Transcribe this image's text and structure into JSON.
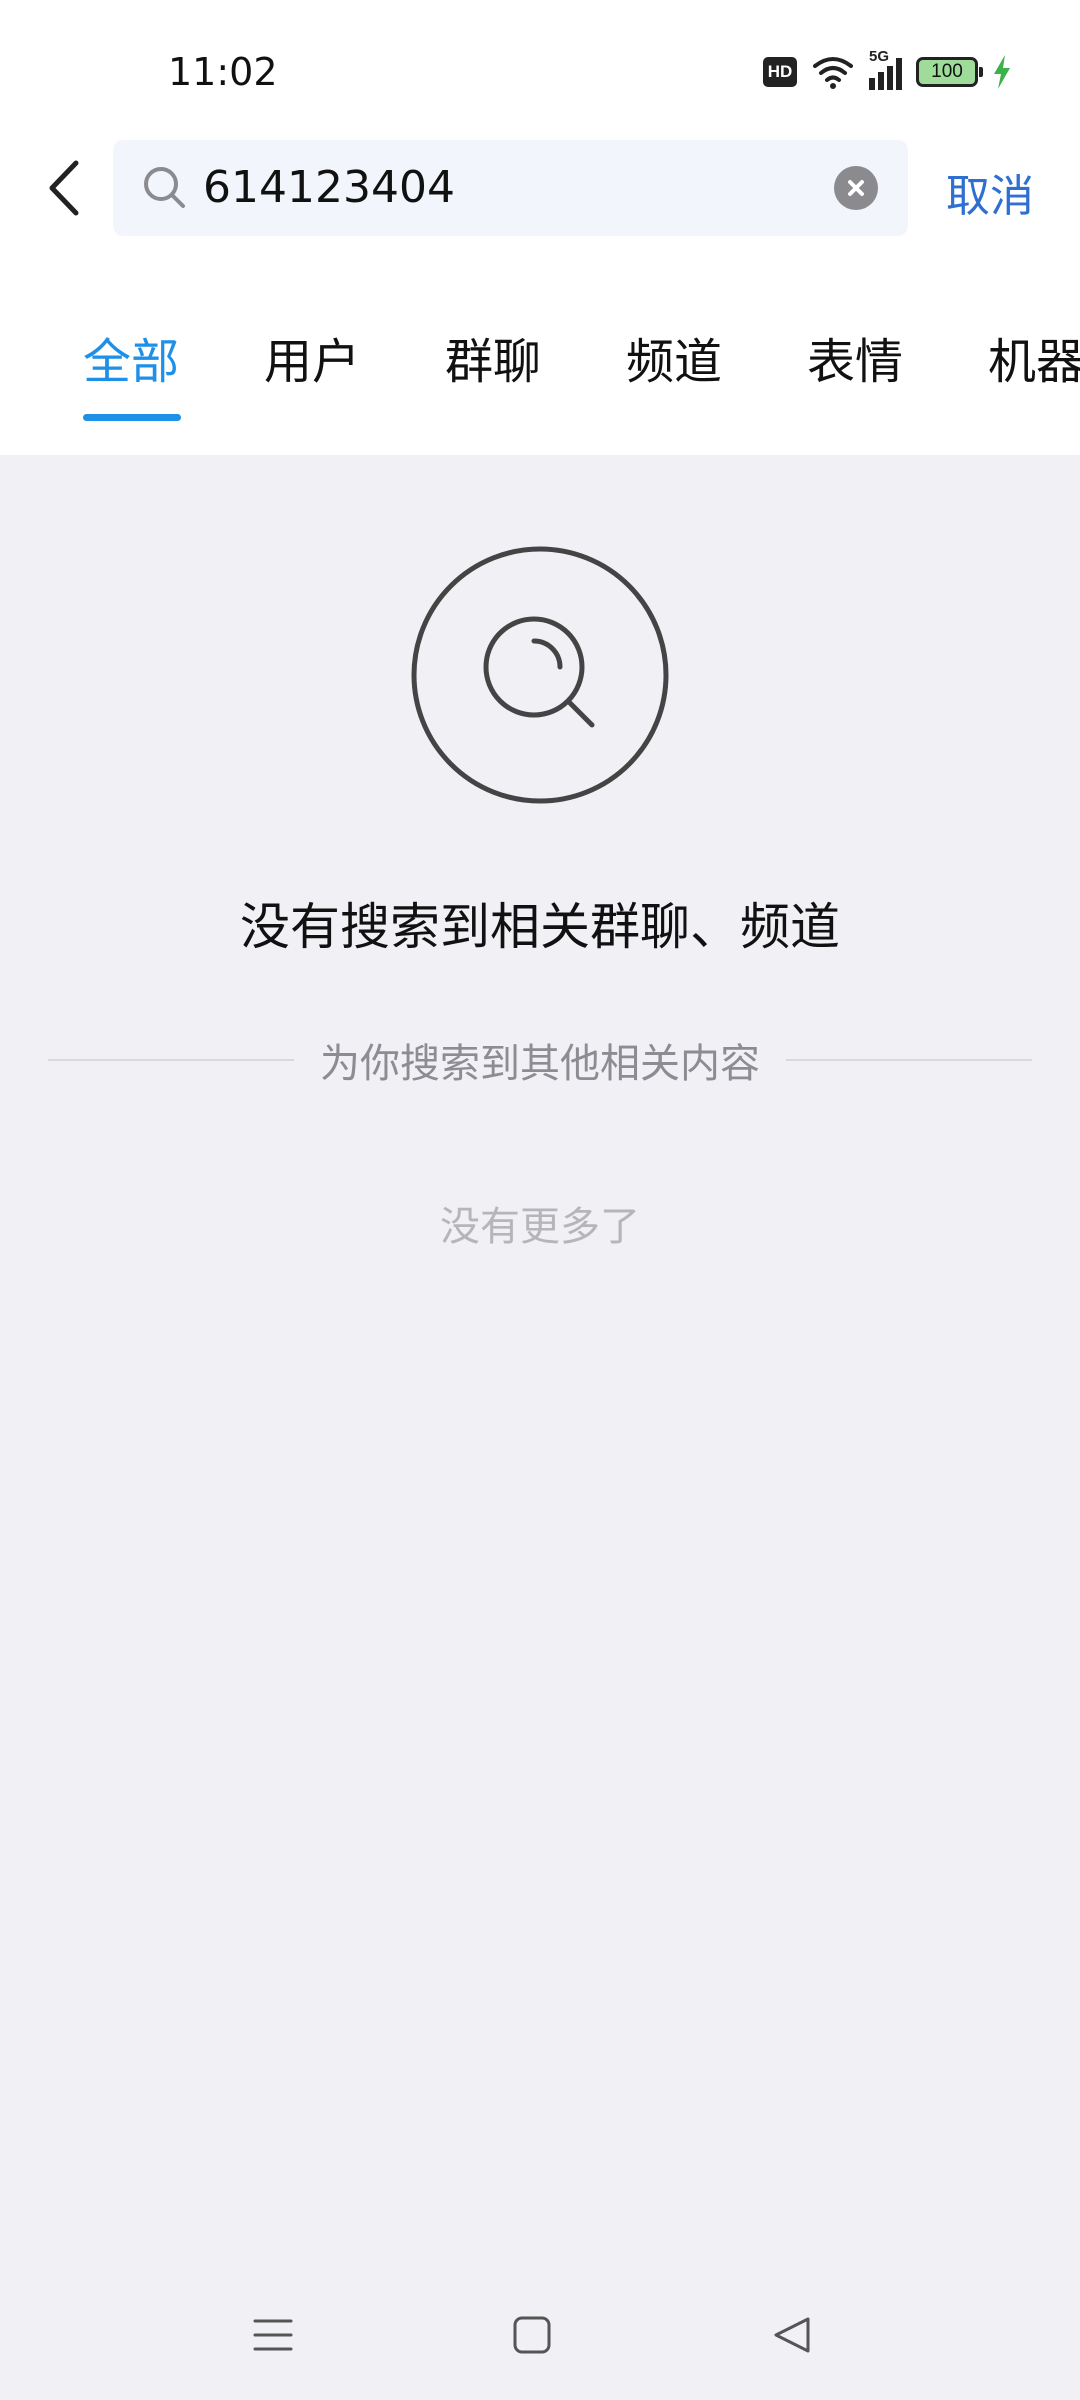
{
  "status_bar": {
    "time": "11:02",
    "network": "5G",
    "hd": "HD",
    "battery": "100"
  },
  "search": {
    "query": "614123404",
    "cancel_label": "取消"
  },
  "tabs": [
    {
      "label": "全部",
      "active": true
    },
    {
      "label": "用户",
      "active": false
    },
    {
      "label": "群聊",
      "active": false
    },
    {
      "label": "频道",
      "active": false
    },
    {
      "label": "表情",
      "active": false
    },
    {
      "label": "机器",
      "active": false
    }
  ],
  "empty_state": {
    "title": "没有搜索到相关群聊、频道",
    "related_divider": "为你搜索到其他相关内容",
    "no_more": "没有更多了"
  },
  "colors": {
    "accent": "#1e90e8",
    "cancel": "#2f6fd0",
    "background": "#f0f0f5"
  }
}
